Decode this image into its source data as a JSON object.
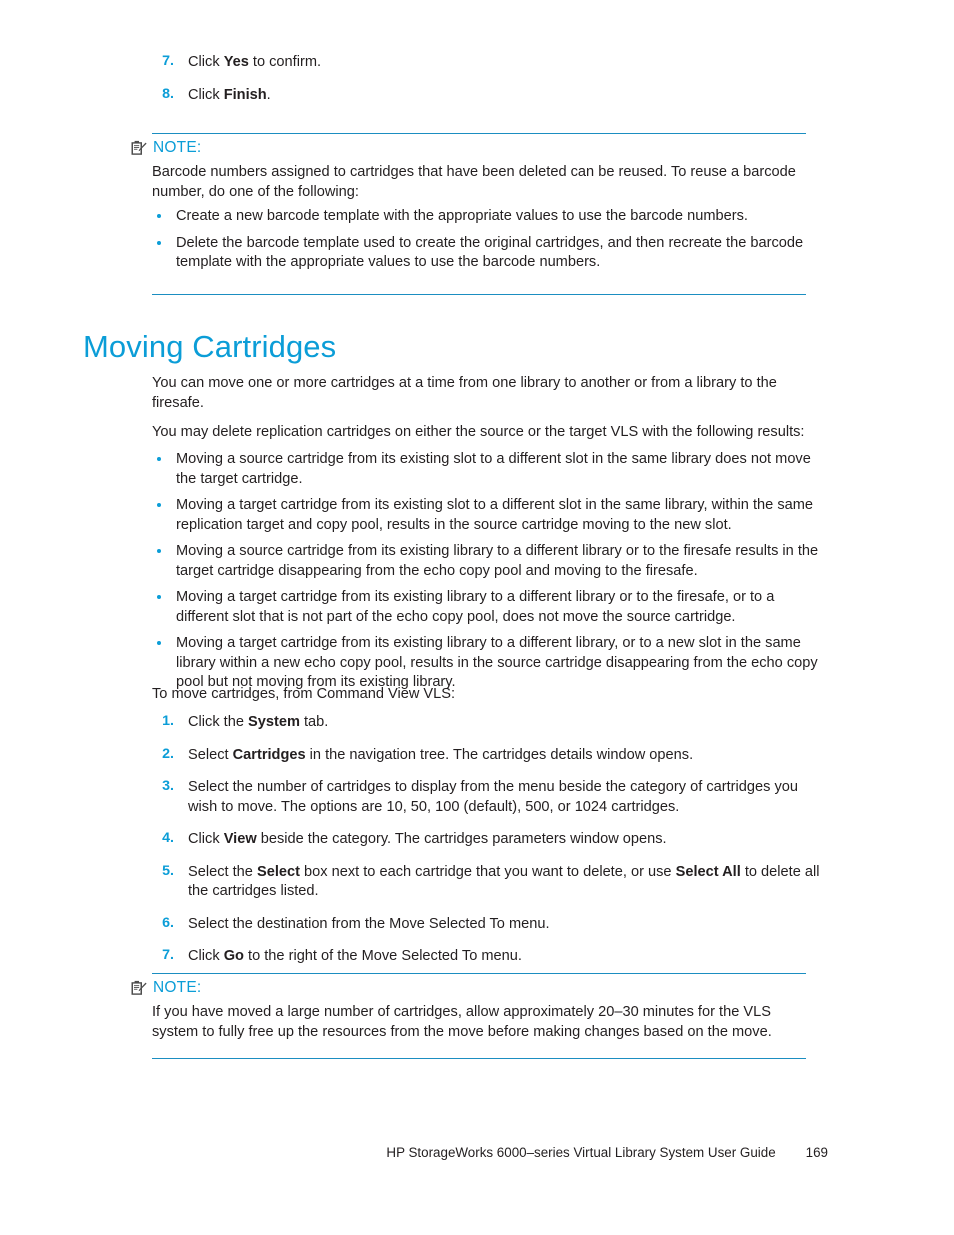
{
  "colors": {
    "accent_blue": "#0b9dd7",
    "rule_blue": "#1b8ec1",
    "body_text": "#231f20"
  },
  "top_steps": [
    {
      "num": "7.",
      "pre": "Click ",
      "bold": "Yes",
      "post": " to confirm."
    },
    {
      "num": "8.",
      "pre": "Click ",
      "bold": "Finish",
      "post": "."
    }
  ],
  "note_one": {
    "icon": "note-clipboard-icon",
    "label": "NOTE:",
    "paragraph": "Barcode numbers assigned to cartridges that have been deleted can be reused. To reuse a barcode number, do one of the following:",
    "bullets": [
      "Create a new barcode template with the appropriate values to use the barcode numbers.",
      "Delete the barcode template used to create the original cartridges, and then recreate the barcode template with the appropriate values to use the barcode numbers."
    ]
  },
  "heading": "Moving Cartridges",
  "intro_paragraphs": [
    "You can move one or more cartridges at a time from one library to another or from a library to the firesafe.",
    "You may delete replication cartridges on either the source or the target VLS with the following results:"
  ],
  "result_bullets": [
    "Moving a source cartridge from its existing slot to a different slot in the same library does not move the target cartridge.",
    "Moving a target cartridge from its existing slot to a different slot in the same library, within the same replication target and copy pool, results in the source cartridge moving to the new slot.",
    "Moving a source cartridge from its existing library to a different library or to the firesafe results in the target cartridge disappearing from the echo copy pool and moving to the firesafe.",
    "Moving a target cartridge from its existing library to a different library or to the firesafe, or to a different slot that is not part of the echo copy pool, does not move the source cartridge.",
    "Moving a target cartridge from its existing library to a different library, or to a new slot in the same library within a new echo copy pool, results in the source cartridge disappearing from the echo copy pool but not moving from its existing library."
  ],
  "procedure_lead": "To move cartridges, from Command View VLS:",
  "procedure_steps": [
    {
      "num": "1.",
      "parts": [
        {
          "t": "Click the "
        },
        {
          "t": "System",
          "b": true
        },
        {
          "t": " tab."
        }
      ]
    },
    {
      "num": "2.",
      "parts": [
        {
          "t": "Select "
        },
        {
          "t": "Cartridges",
          "b": true
        },
        {
          "t": " in the navigation tree. The cartridges details window opens."
        }
      ]
    },
    {
      "num": "3.",
      "parts": [
        {
          "t": "Select the number of cartridges to display from the menu beside the category of cartridges you wish to move. The options are 10, 50, 100 (default), 500, or 1024 cartridges."
        }
      ]
    },
    {
      "num": "4.",
      "parts": [
        {
          "t": "Click "
        },
        {
          "t": "View",
          "b": true
        },
        {
          "t": " beside the category. The cartridges parameters window opens."
        }
      ]
    },
    {
      "num": "5.",
      "parts": [
        {
          "t": "Select the "
        },
        {
          "t": "Select",
          "b": true
        },
        {
          "t": " box next to each cartridge that you want to delete, or use "
        },
        {
          "t": "Select All",
          "b": true
        },
        {
          "t": " to delete all the cartridges listed."
        }
      ]
    },
    {
      "num": "6.",
      "parts": [
        {
          "t": "Select the destination from the Move Selected To menu."
        }
      ]
    },
    {
      "num": "7.",
      "parts": [
        {
          "t": "Click "
        },
        {
          "t": "Go",
          "b": true
        },
        {
          "t": " to the right of the Move Selected To menu."
        }
      ]
    }
  ],
  "note_two": {
    "icon": "note-clipboard-icon",
    "label": "NOTE:",
    "paragraph": "If you have moved a large number of cartridges, allow approximately 20–30 minutes for the VLS system to fully free up the resources from the move before making changes based on the move."
  },
  "footer": {
    "title": "HP StorageWorks 6000–series Virtual Library System User Guide",
    "page_number": "169"
  }
}
